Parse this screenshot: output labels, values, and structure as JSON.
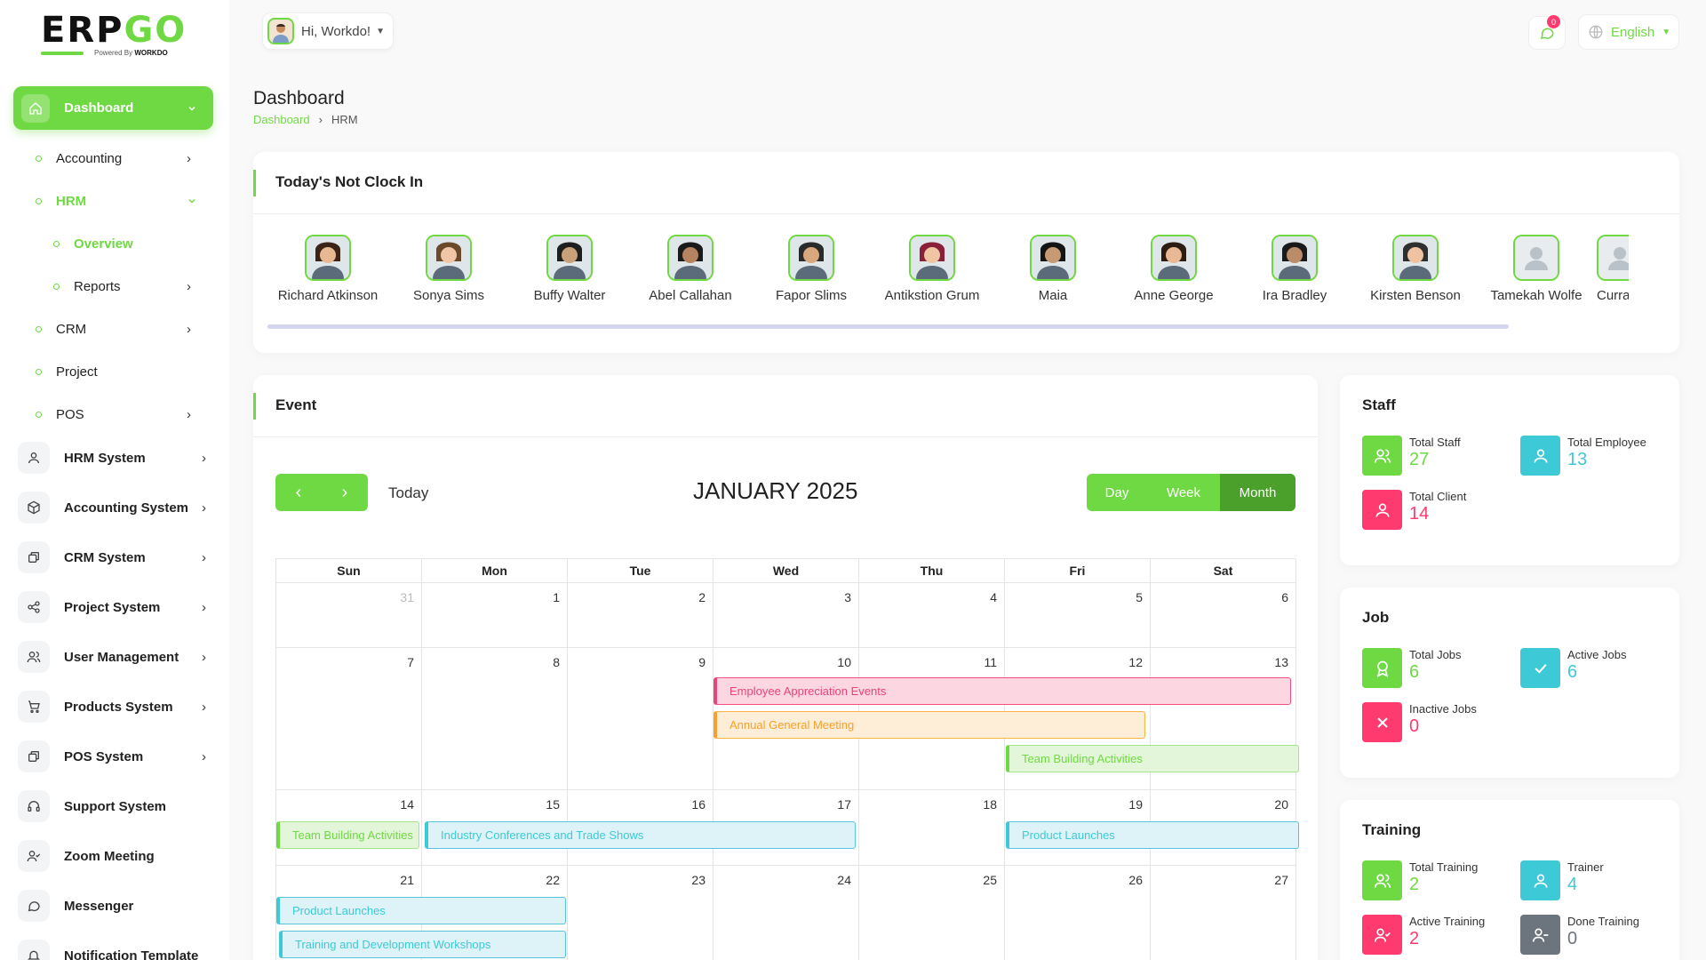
{
  "brand": {
    "logo_text_a": "ERP",
    "logo_text_b": "GO",
    "powered": "Powered By",
    "powered_brand": "WORKDO"
  },
  "header": {
    "greeting": "Hi, Workdo!",
    "notification_count": "0",
    "language": "English"
  },
  "page": {
    "title": "Dashboard",
    "breadcrumb": [
      "Dashboard",
      "HRM"
    ]
  },
  "sidebar": {
    "dashboard": "Dashboard",
    "sub_items": [
      "Accounting",
      "HRM",
      "Overview",
      "Reports",
      "CRM",
      "Project",
      "POS"
    ],
    "modules": [
      "HRM System",
      "Accounting System",
      "CRM System",
      "Project System",
      "User Management",
      "Products System",
      "POS System",
      "Support System",
      "Zoom Meeting",
      "Messenger",
      "Notification Template"
    ]
  },
  "not_clock_in": {
    "title": "Today's Not Clock In",
    "employees": [
      "Richard Atkinson",
      "Sonya Sims",
      "Buffy Walter",
      "Abel Callahan",
      "Fapor Slims",
      "Antikstion Grum",
      "Maia",
      "Anne George",
      "Ira Bradley",
      "Kirsten Benson",
      "Tamekah Wolfe",
      "Curran F"
    ]
  },
  "event": {
    "title": "Event",
    "today": "Today",
    "month": "JANUARY 2025",
    "views": [
      "Day",
      "Week",
      "Month"
    ],
    "weekdays": [
      "Sun",
      "Mon",
      "Tue",
      "Wed",
      "Thu",
      "Fri",
      "Sat"
    ],
    "weeks": [
      [
        "31",
        "1",
        "2",
        "3",
        "4",
        "5",
        "6"
      ],
      [
        "7",
        "8",
        "9",
        "10",
        "11",
        "12",
        "13"
      ],
      [
        "14",
        "15",
        "16",
        "17",
        "18",
        "19",
        "20"
      ],
      [
        "21",
        "22",
        "23",
        "24",
        "25",
        "26",
        "27"
      ]
    ],
    "events": [
      {
        "label": "Employee Appreciation Events",
        "color": "pink"
      },
      {
        "label": "Annual General Meeting",
        "color": "orange"
      },
      {
        "label": "Team Building Activities",
        "color": "lgreen"
      },
      {
        "label": "Team Building Activities",
        "color": "lgreen"
      },
      {
        "label": "Industry Conferences and Trade Shows",
        "color": "cyan"
      },
      {
        "label": "Product Launches",
        "color": "cyan"
      },
      {
        "label": "Product Launches",
        "color": "cyan"
      },
      {
        "label": "Training and Development Workshops",
        "color": "cyan"
      }
    ]
  },
  "staff": {
    "title": "Staff",
    "items": [
      {
        "label": "Total Staff",
        "value": "27",
        "color": "#6fd943"
      },
      {
        "label": "Total Employee",
        "value": "13",
        "color": "#3ec9d6"
      },
      {
        "label": "Total Client",
        "value": "14",
        "color": "#ff3a6e"
      }
    ]
  },
  "job": {
    "title": "Job",
    "items": [
      {
        "label": "Total Jobs",
        "value": "6",
        "color": "#6fd943"
      },
      {
        "label": "Active Jobs",
        "value": "6",
        "color": "#3ec9d6"
      },
      {
        "label": "Inactive Jobs",
        "value": "0",
        "color": "#ff3a6e"
      }
    ]
  },
  "training": {
    "title": "Training",
    "items": [
      {
        "label": "Total Training",
        "value": "2",
        "color": "#6fd943"
      },
      {
        "label": "Trainer",
        "value": "4",
        "color": "#3ec9d6"
      },
      {
        "label": "Active Training",
        "value": "2",
        "color": "#ff3a6e"
      },
      {
        "label": "Done Training",
        "value": "0",
        "color": "#6c757d"
      }
    ]
  }
}
